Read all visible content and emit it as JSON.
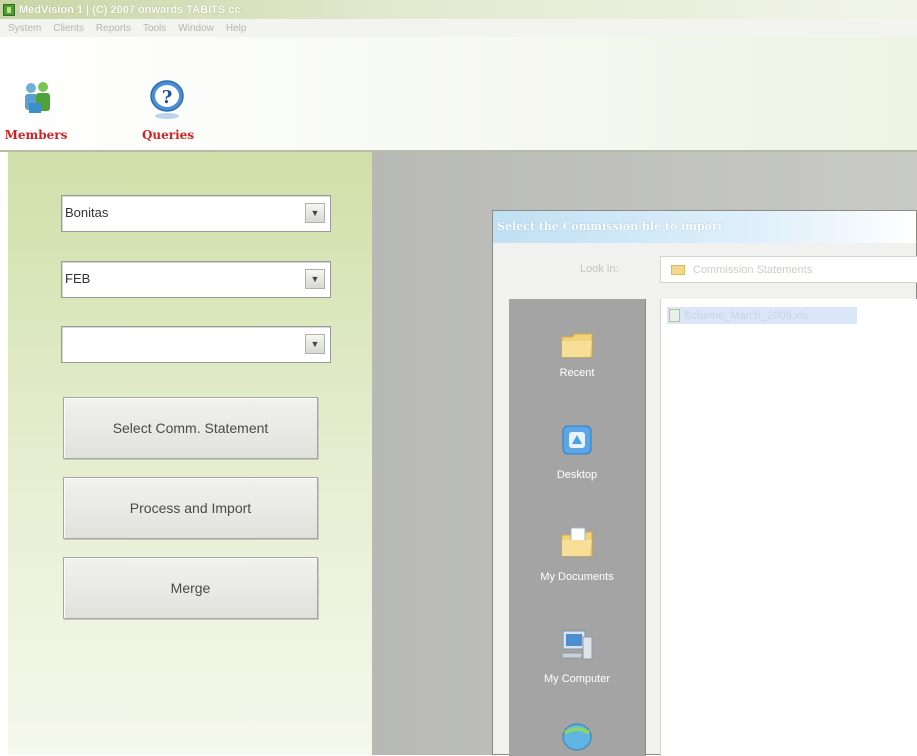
{
  "window": {
    "title": "MedVision 1  |  (C) 2007 onwards TABITS cc"
  },
  "menu": [
    "System",
    "Clients",
    "Reports",
    "Tools",
    "Window",
    "Help"
  ],
  "toolbar": {
    "members_label": "Members",
    "members_icon": "members-icon",
    "queries_label": "Queries",
    "queries_icon": "question-icon"
  },
  "form": {
    "scheme_value": "Bonitas",
    "month_value": "FEB",
    "third_value": "",
    "select_button": "Select Comm. Statement",
    "process_button": "Process and Import",
    "merge_button": "Merge"
  },
  "dialog": {
    "title": "Select the Commission file to import",
    "look_in_label": "Look in:",
    "look_in_value": "Commission Statements",
    "places": [
      {
        "label": "Recent",
        "icon": "recent-folder-icon"
      },
      {
        "label": "Desktop",
        "icon": "desktop-icon"
      },
      {
        "label": "My Documents",
        "icon": "my-documents-icon"
      },
      {
        "label": "My Computer",
        "icon": "my-computer-icon"
      },
      {
        "label": "",
        "icon": "network-places-icon"
      }
    ],
    "files": [
      "Scheme_March_2009.xls"
    ]
  },
  "colors": {
    "toolbar_label": "#d32121",
    "left_pane": "#cfe0a9",
    "dialog_title": "#bfe0f3",
    "places_bar": "#a3a4a3"
  }
}
